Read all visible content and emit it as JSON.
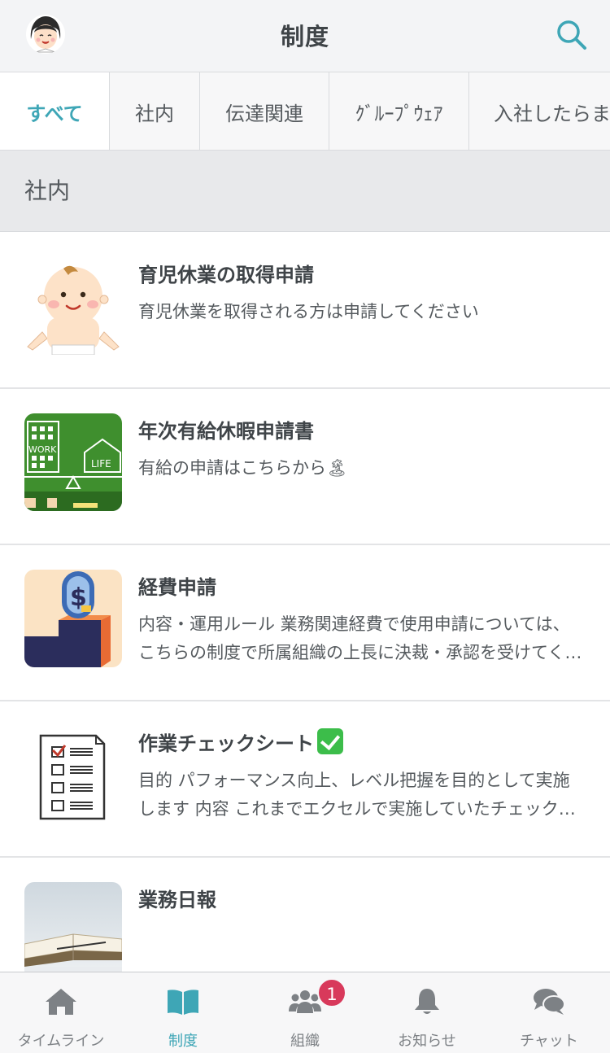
{
  "header": {
    "title": "制度",
    "avatar_icon": "user-avatar-icon",
    "search_icon": "search-icon"
  },
  "tabs": [
    {
      "label": "すべて",
      "active": true
    },
    {
      "label": "社内",
      "active": false
    },
    {
      "label": "伝達関連",
      "active": false
    },
    {
      "label": "ｸﾞﾙｰﾌﾟｳｪｱ",
      "active": false
    },
    {
      "label": "入社したらま",
      "active": false
    }
  ],
  "section": {
    "label": "社内"
  },
  "items": [
    {
      "title": "育児休業の取得申請",
      "desc": "育児休業を取得される方は申請してください",
      "thumb": "baby-illustration"
    },
    {
      "title": "年次有給休暇申請書",
      "desc": "有給の申請はこちらから🏝",
      "thumb": "work-life-balance-image",
      "thumb_text_work": "WORK",
      "thumb_text_life": "LIFE"
    },
    {
      "title": "経費申請",
      "desc": "内容・運用ルール 業務関連経費で使用申請については、こちらの制度で所属組織の上長に決裁・承認を受けてください",
      "thumb": "expense-coin-illustration"
    },
    {
      "title": "作業チェックシート",
      "desc": "目的 パフォーマンス向上、レベル把握を目的として実施します 内容 これまでエクセルで実施していたチェックシートを移行しました",
      "thumb": "checklist-illustration"
    },
    {
      "title": "業務日報",
      "desc": "",
      "thumb": "notebook-photo"
    }
  ],
  "bottom_nav": [
    {
      "label": "タイムライン",
      "icon": "home-icon",
      "active": false
    },
    {
      "label": "制度",
      "icon": "book-icon",
      "active": true
    },
    {
      "label": "組織",
      "icon": "users-icon",
      "active": false
    },
    {
      "label": "お知らせ",
      "icon": "bell-icon",
      "active": false,
      "badge": "1"
    },
    {
      "label": "チャット",
      "icon": "chat-icon",
      "active": false
    }
  ],
  "colors": {
    "accent": "#3ea6b6",
    "badge": "#d8395b",
    "header_bg": "#f3f4f6",
    "section_bg": "#e8e9eb"
  }
}
